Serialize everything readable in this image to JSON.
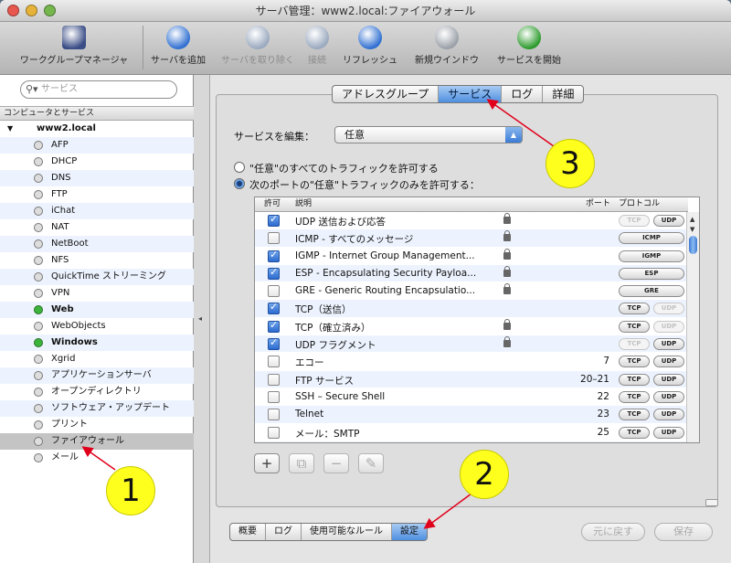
{
  "window": {
    "title": "サーバ管理：www2.local:ファイアウォール"
  },
  "toolbar": [
    {
      "label": "ワークグループマネージャ",
      "icon": "workgroup-manager-icon",
      "disabled": false
    },
    {
      "label": "サーバを追加",
      "icon": "add-server-icon",
      "disabled": false
    },
    {
      "label": "サーバを取り除く",
      "icon": "remove-server-icon",
      "disabled": true
    },
    {
      "label": "接続",
      "icon": "connect-icon",
      "disabled": true
    },
    {
      "label": "リフレッシュ",
      "icon": "refresh-icon",
      "disabled": false
    },
    {
      "label": "新規ウインドウ",
      "icon": "new-window-icon",
      "disabled": false
    },
    {
      "label": "サービスを開始",
      "icon": "start-service-icon",
      "disabled": false
    }
  ],
  "sidebar": {
    "search_placeholder": "サービス",
    "header": "コンピュータとサービス",
    "server": "www2.local",
    "items": [
      {
        "label": "AFP",
        "on": false
      },
      {
        "label": "DHCP",
        "on": false
      },
      {
        "label": "DNS",
        "on": false
      },
      {
        "label": "FTP",
        "on": false
      },
      {
        "label": "iChat",
        "on": false
      },
      {
        "label": "NAT",
        "on": false
      },
      {
        "label": "NetBoot",
        "on": false
      },
      {
        "label": "NFS",
        "on": false
      },
      {
        "label": "QuickTime ストリーミング",
        "on": false
      },
      {
        "label": "VPN",
        "on": false
      },
      {
        "label": "Web",
        "on": true
      },
      {
        "label": "WebObjects",
        "on": false
      },
      {
        "label": "Windows",
        "on": true
      },
      {
        "label": "Xgrid",
        "on": false
      },
      {
        "label": "アプリケーションサーバ",
        "on": false
      },
      {
        "label": "オープンディレクトリ",
        "on": false
      },
      {
        "label": "ソフトウェア・アップデート",
        "on": false
      },
      {
        "label": "プリント",
        "on": false
      },
      {
        "label": "ファイアウォール",
        "on": false,
        "selected": true
      },
      {
        "label": "メール",
        "on": false
      }
    ]
  },
  "tabs": [
    "アドレスグループ",
    "サービス",
    "ログ",
    "詳細"
  ],
  "active_tab": "サービス",
  "edit_label": "サービスを編集：",
  "edit_value": "任意",
  "radio_all": "\"任意\"のすべてのトラフィックを許可する",
  "radio_ports": "次のポートの\"任意\"トラフィックのみを許可する：",
  "table": {
    "headers": {
      "allow": "許可",
      "desc": "説明",
      "port": "ポート",
      "proto": "プロトコル"
    },
    "rows": [
      {
        "on": true,
        "desc": "UDP 送信および応答",
        "lock": true,
        "port": "",
        "tcp": "dis",
        "udp": "on"
      },
      {
        "on": false,
        "desc": "ICMP - すべてのメッセージ",
        "lock": true,
        "port": "",
        "single": "ICMP"
      },
      {
        "on": true,
        "desc": "IGMP - Internet Group Management...",
        "lock": true,
        "port": "",
        "single": "IGMP"
      },
      {
        "on": true,
        "desc": "ESP - Encapsulating Security Payloa...",
        "lock": true,
        "port": "",
        "single": "ESP"
      },
      {
        "on": false,
        "desc": "GRE - Generic Routing Encapsulatio...",
        "lock": true,
        "port": "",
        "single": "GRE"
      },
      {
        "on": true,
        "desc": "TCP（送信）",
        "lock": false,
        "port": "",
        "tcp": "on",
        "udp": "dis"
      },
      {
        "on": true,
        "desc": "TCP（確立済み）",
        "lock": true,
        "port": "",
        "tcp": "on",
        "udp": "dis"
      },
      {
        "on": true,
        "desc": "UDP フラグメント",
        "lock": true,
        "port": "",
        "tcp": "dis",
        "udp": "on"
      },
      {
        "on": false,
        "desc": "エコー",
        "lock": false,
        "port": "7",
        "tcp": "on",
        "udp": "on"
      },
      {
        "on": false,
        "desc": "FTP サービス",
        "lock": false,
        "port": "20–21",
        "tcp": "on",
        "udp": "on"
      },
      {
        "on": false,
        "desc": "SSH – Secure Shell",
        "lock": false,
        "port": "22",
        "tcp": "on",
        "udp": "on"
      },
      {
        "on": false,
        "desc": "Telnet",
        "lock": false,
        "port": "23",
        "tcp": "on",
        "udp": "on"
      },
      {
        "on": false,
        "desc": "メール：SMTP",
        "lock": false,
        "port": "25",
        "tcp": "on",
        "udp": "on"
      },
      {
        "on": false,
        "desc": "",
        "lock": false,
        "port": "",
        "tcp": "on",
        "udp": "on"
      }
    ],
    "tcp_label": "TCP",
    "udp_label": "UDP"
  },
  "table_buttons": [
    "+",
    "⧉",
    "−",
    "✎"
  ],
  "bottom_tabs": [
    "概要",
    "ログ",
    "使用可能なルール",
    "設定"
  ],
  "active_bottom": "設定",
  "revert": "元に戻す",
  "save": "保存",
  "callouts": [
    "1",
    "2",
    "3"
  ],
  "colors": {
    "callout": "#ffff1e",
    "arrow": "#e0001b",
    "accent": "#4f8fe0",
    "on_dot": "#3cb43c"
  }
}
